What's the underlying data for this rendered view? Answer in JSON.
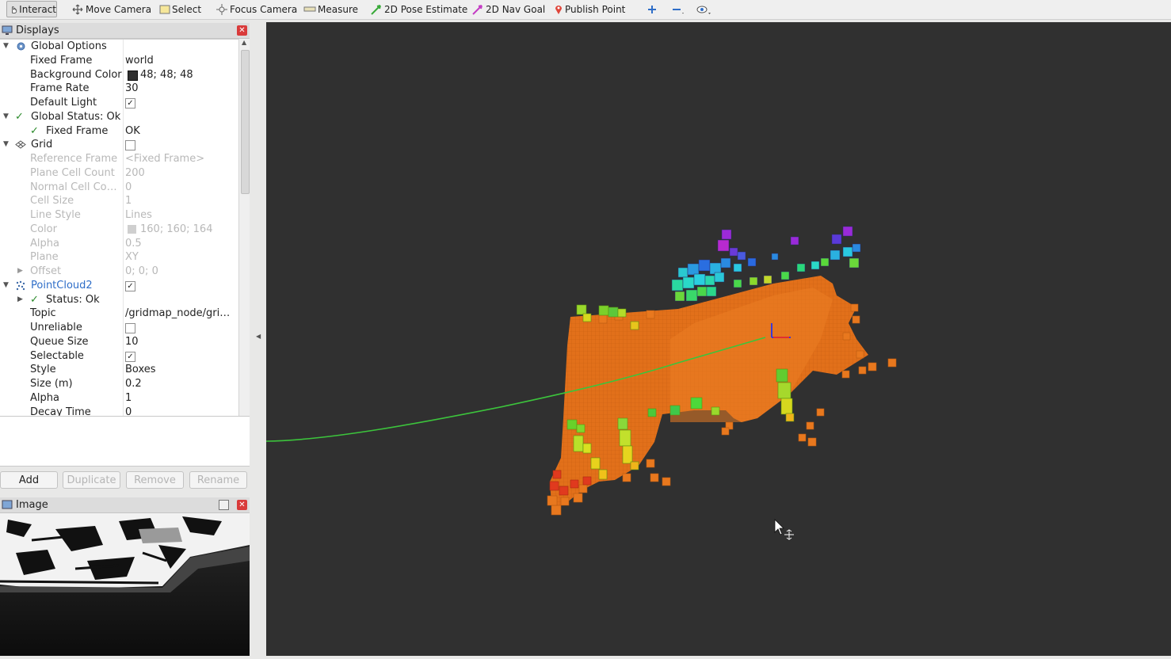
{
  "toolbar": {
    "interact": "Interact",
    "move_camera": "Move Camera",
    "select": "Select",
    "focus_camera": "Focus Camera",
    "measure": "Measure",
    "pose_estimate": "2D Pose Estimate",
    "nav_goal": "2D Nav Goal",
    "publish_point": "Publish Point"
  },
  "displays": {
    "title": "Displays",
    "rows": [
      {
        "key": "Global Options",
        "value": ""
      },
      {
        "key": "Fixed Frame",
        "value": "world"
      },
      {
        "key": "Background Color",
        "value": "48; 48; 48"
      },
      {
        "key": "Frame Rate",
        "value": "30"
      },
      {
        "key": "Default Light",
        "value": "✓"
      },
      {
        "key": "Global Status: Ok",
        "value": ""
      },
      {
        "key": "Fixed Frame",
        "value": "OK"
      },
      {
        "key": "Grid",
        "value": ""
      },
      {
        "key": "Reference Frame",
        "value": "<Fixed Frame>"
      },
      {
        "key": "Plane Cell Count",
        "value": "200"
      },
      {
        "key": "Normal Cell Co…",
        "value": "0"
      },
      {
        "key": "Cell Size",
        "value": "1"
      },
      {
        "key": "Line Style",
        "value": "Lines"
      },
      {
        "key": "Color",
        "value": "160; 160; 164"
      },
      {
        "key": "Alpha",
        "value": "0.5"
      },
      {
        "key": "Plane",
        "value": "XY"
      },
      {
        "key": "Offset",
        "value": "0; 0; 0"
      },
      {
        "key": "PointCloud2",
        "value": "✓"
      },
      {
        "key": "Status: Ok",
        "value": ""
      },
      {
        "key": "Topic",
        "value": "/gridmap_node/gri…"
      },
      {
        "key": "Unreliable",
        "value": ""
      },
      {
        "key": "Queue Size",
        "value": "10"
      },
      {
        "key": "Selectable",
        "value": "✓"
      },
      {
        "key": "Style",
        "value": "Boxes"
      },
      {
        "key": "Size (m)",
        "value": "0.2"
      },
      {
        "key": "Alpha",
        "value": "1"
      },
      {
        "key": "Decay Time",
        "value": "0"
      }
    ]
  },
  "buttons": {
    "add": "Add",
    "duplicate": "Duplicate",
    "remove": "Remove",
    "rename": "Rename"
  },
  "image_panel": {
    "title": "Image"
  },
  "colors": {
    "background": "#303030",
    "path": "#3cc43c",
    "ground": "#e8701a",
    "accent": "#2f6ec8"
  }
}
